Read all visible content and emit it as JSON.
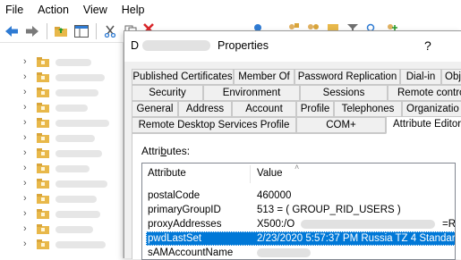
{
  "menu": [
    "File",
    "Action",
    "View",
    "Help"
  ],
  "dialog": {
    "title_prefix": "D",
    "title_suffix": "Properties",
    "help_glyph": "?",
    "tabs_row1": [
      "Published Certificates",
      "Member Of",
      "Password Replication",
      "Dial-in",
      "Obj"
    ],
    "tabs_row2": [
      "Security",
      "Environment",
      "Sessions",
      "Remote control"
    ],
    "tabs_row3": [
      "General",
      "Address",
      "Account",
      "Profile",
      "Telephones",
      "Organizatio"
    ],
    "tabs_row4": [
      "Remote Desktop Services Profile",
      "COM+",
      "Attribute Editor"
    ],
    "attributes_label_pre": "Attri",
    "attributes_label_u": "b",
    "attributes_label_post": "utes:",
    "columns": {
      "attribute": "Attribute",
      "value": "Value"
    },
    "rows": [
      {
        "attribute": "postalCode",
        "value": "460000"
      },
      {
        "attribute": "primaryGroupID",
        "value": "513 = ( GROUP_RID_USERS )"
      },
      {
        "attribute": "proxyAddresses",
        "value_start": "X500:/O",
        "value_end": "=R"
      },
      {
        "attribute": "pwdLastSet",
        "value": "2/23/2020 5:57:37 PM Russia TZ 4 Standar"
      },
      {
        "attribute": "sAMAccountName",
        "value": ""
      }
    ],
    "selected_row": "pwdLastSet"
  },
  "colors": {
    "selection": "#0078d7",
    "folder": "#e8b84a",
    "red_x": "#d9262a"
  }
}
